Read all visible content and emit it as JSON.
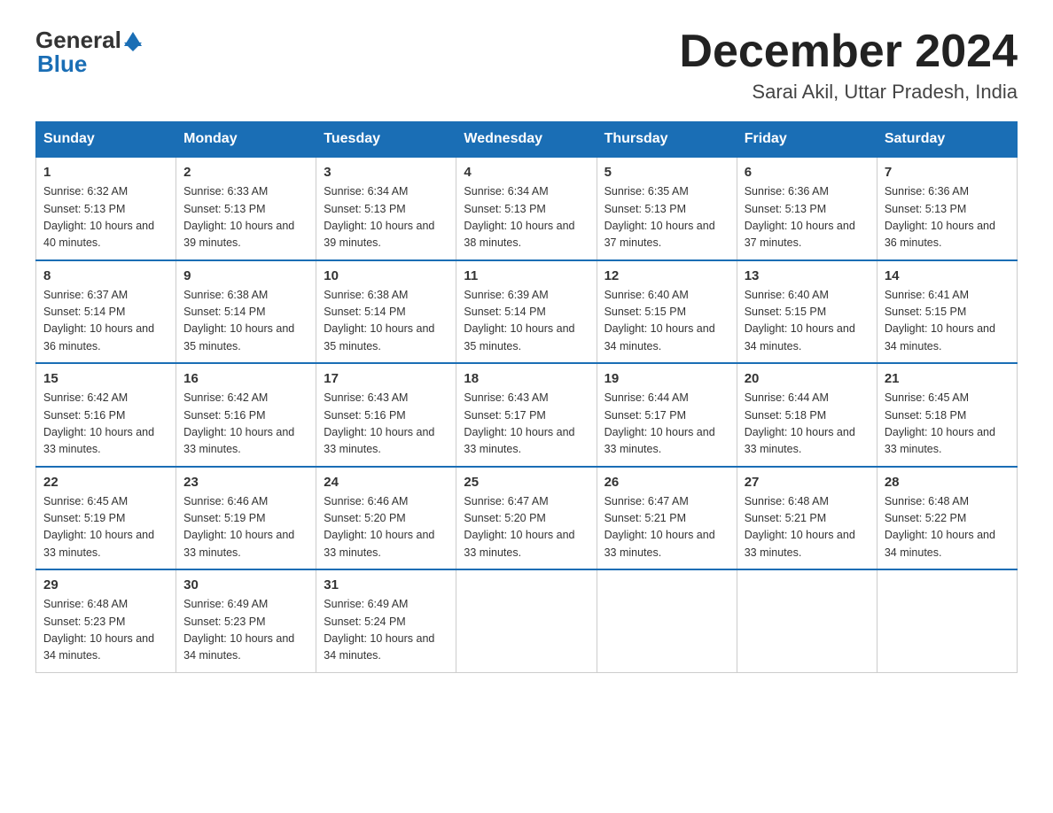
{
  "logo": {
    "text_general": "General",
    "text_blue": "Blue",
    "arrow": "▲"
  },
  "header": {
    "month_title": "December 2024",
    "location": "Sarai Akil, Uttar Pradesh, India"
  },
  "days_of_week": [
    "Sunday",
    "Monday",
    "Tuesday",
    "Wednesday",
    "Thursday",
    "Friday",
    "Saturday"
  ],
  "weeks": [
    [
      {
        "num": "1",
        "sunrise": "6:32 AM",
        "sunset": "5:13 PM",
        "daylight": "10 hours and 40 minutes."
      },
      {
        "num": "2",
        "sunrise": "6:33 AM",
        "sunset": "5:13 PM",
        "daylight": "10 hours and 39 minutes."
      },
      {
        "num": "3",
        "sunrise": "6:34 AM",
        "sunset": "5:13 PM",
        "daylight": "10 hours and 39 minutes."
      },
      {
        "num": "4",
        "sunrise": "6:34 AM",
        "sunset": "5:13 PM",
        "daylight": "10 hours and 38 minutes."
      },
      {
        "num": "5",
        "sunrise": "6:35 AM",
        "sunset": "5:13 PM",
        "daylight": "10 hours and 37 minutes."
      },
      {
        "num": "6",
        "sunrise": "6:36 AM",
        "sunset": "5:13 PM",
        "daylight": "10 hours and 37 minutes."
      },
      {
        "num": "7",
        "sunrise": "6:36 AM",
        "sunset": "5:13 PM",
        "daylight": "10 hours and 36 minutes."
      }
    ],
    [
      {
        "num": "8",
        "sunrise": "6:37 AM",
        "sunset": "5:14 PM",
        "daylight": "10 hours and 36 minutes."
      },
      {
        "num": "9",
        "sunrise": "6:38 AM",
        "sunset": "5:14 PM",
        "daylight": "10 hours and 35 minutes."
      },
      {
        "num": "10",
        "sunrise": "6:38 AM",
        "sunset": "5:14 PM",
        "daylight": "10 hours and 35 minutes."
      },
      {
        "num": "11",
        "sunrise": "6:39 AM",
        "sunset": "5:14 PM",
        "daylight": "10 hours and 35 minutes."
      },
      {
        "num": "12",
        "sunrise": "6:40 AM",
        "sunset": "5:15 PM",
        "daylight": "10 hours and 34 minutes."
      },
      {
        "num": "13",
        "sunrise": "6:40 AM",
        "sunset": "5:15 PM",
        "daylight": "10 hours and 34 minutes."
      },
      {
        "num": "14",
        "sunrise": "6:41 AM",
        "sunset": "5:15 PM",
        "daylight": "10 hours and 34 minutes."
      }
    ],
    [
      {
        "num": "15",
        "sunrise": "6:42 AM",
        "sunset": "5:16 PM",
        "daylight": "10 hours and 33 minutes."
      },
      {
        "num": "16",
        "sunrise": "6:42 AM",
        "sunset": "5:16 PM",
        "daylight": "10 hours and 33 minutes."
      },
      {
        "num": "17",
        "sunrise": "6:43 AM",
        "sunset": "5:16 PM",
        "daylight": "10 hours and 33 minutes."
      },
      {
        "num": "18",
        "sunrise": "6:43 AM",
        "sunset": "5:17 PM",
        "daylight": "10 hours and 33 minutes."
      },
      {
        "num": "19",
        "sunrise": "6:44 AM",
        "sunset": "5:17 PM",
        "daylight": "10 hours and 33 minutes."
      },
      {
        "num": "20",
        "sunrise": "6:44 AM",
        "sunset": "5:18 PM",
        "daylight": "10 hours and 33 minutes."
      },
      {
        "num": "21",
        "sunrise": "6:45 AM",
        "sunset": "5:18 PM",
        "daylight": "10 hours and 33 minutes."
      }
    ],
    [
      {
        "num": "22",
        "sunrise": "6:45 AM",
        "sunset": "5:19 PM",
        "daylight": "10 hours and 33 minutes."
      },
      {
        "num": "23",
        "sunrise": "6:46 AM",
        "sunset": "5:19 PM",
        "daylight": "10 hours and 33 minutes."
      },
      {
        "num": "24",
        "sunrise": "6:46 AM",
        "sunset": "5:20 PM",
        "daylight": "10 hours and 33 minutes."
      },
      {
        "num": "25",
        "sunrise": "6:47 AM",
        "sunset": "5:20 PM",
        "daylight": "10 hours and 33 minutes."
      },
      {
        "num": "26",
        "sunrise": "6:47 AM",
        "sunset": "5:21 PM",
        "daylight": "10 hours and 33 minutes."
      },
      {
        "num": "27",
        "sunrise": "6:48 AM",
        "sunset": "5:21 PM",
        "daylight": "10 hours and 33 minutes."
      },
      {
        "num": "28",
        "sunrise": "6:48 AM",
        "sunset": "5:22 PM",
        "daylight": "10 hours and 34 minutes."
      }
    ],
    [
      {
        "num": "29",
        "sunrise": "6:48 AM",
        "sunset": "5:23 PM",
        "daylight": "10 hours and 34 minutes."
      },
      {
        "num": "30",
        "sunrise": "6:49 AM",
        "sunset": "5:23 PM",
        "daylight": "10 hours and 34 minutes."
      },
      {
        "num": "31",
        "sunrise": "6:49 AM",
        "sunset": "5:24 PM",
        "daylight": "10 hours and 34 minutes."
      },
      null,
      null,
      null,
      null
    ]
  ],
  "labels": {
    "sunrise_prefix": "Sunrise: ",
    "sunset_prefix": "Sunset: ",
    "daylight_prefix": "Daylight: "
  }
}
